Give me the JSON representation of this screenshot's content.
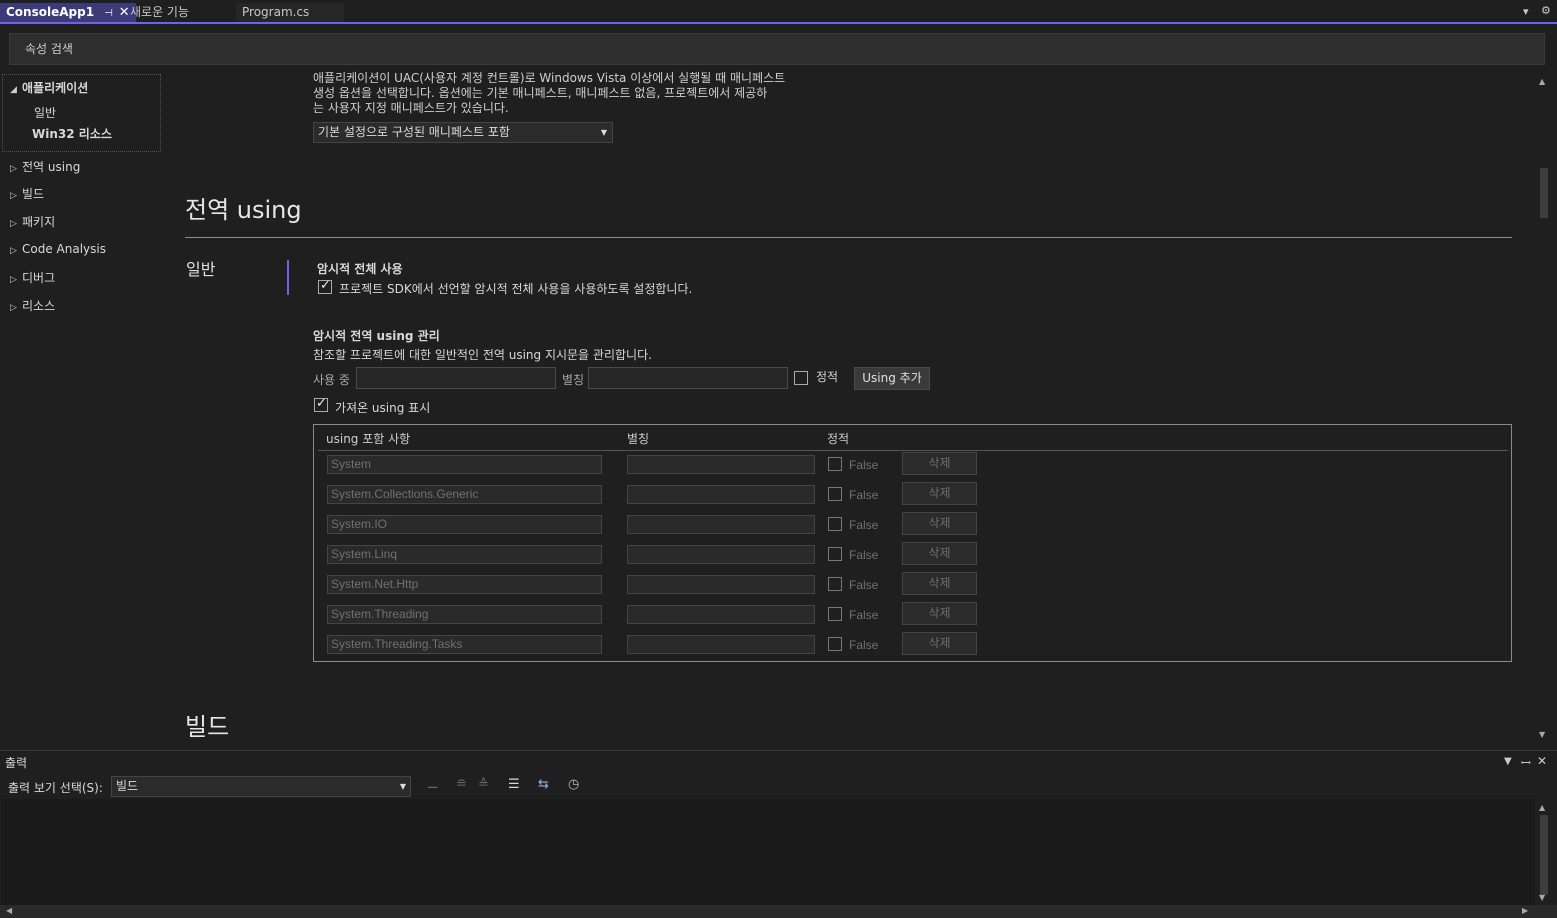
{
  "tabs": [
    {
      "label": "ConsoleApp1",
      "active": true
    },
    {
      "label": "새로운 기능",
      "active": false
    },
    {
      "label": "Program.cs",
      "active": false
    }
  ],
  "search": {
    "placeholder": "속성 검색"
  },
  "nav": {
    "expanded": {
      "label": "애플리케이션",
      "children": [
        "일반",
        "Win32 리소스"
      ]
    },
    "items": [
      "전역 using",
      "빌드",
      "패키지",
      "Code Analysis",
      "디버그",
      "리소스"
    ]
  },
  "manifest": {
    "description_lines": [
      "애플리케이션이 UAC(사용자 계정 컨트롤)로 Windows Vista 이상에서 실행될 때 매니페스트",
      "생성 옵션을 선택합니다. 옵션에는 기본 매니페스트, 매니페스트 없음, 프로젝트에서 제공하",
      "는 사용자 지정 매니페스트가 있습니다."
    ],
    "selected": "기본 설정으로 구성된 매니페스트 포함"
  },
  "global_using": {
    "heading": "전역 using",
    "subsection": "일반",
    "implicit": {
      "title": "암시적 전체 사용",
      "checkbox_label": "프로젝트 SDK에서 선언할 암시적 전체 사용을 사용하도록 설정합니다.",
      "checked": true
    },
    "manage": {
      "title": "암시적 전역 using 관리",
      "desc": "참조할 프로젝트에 대한 일반적인 전역 using 지시문을 관리합니다.",
      "using_label": "사용 중",
      "alias_label": "별칭",
      "static_label": "정적",
      "add_button": "Using 추가",
      "show_imported_label": "가져온 using 표시",
      "show_imported_checked": true
    },
    "table": {
      "headers": [
        "using 포함 사항",
        "별칭",
        "정적"
      ],
      "rows": [
        {
          "using": "System",
          "static": "False",
          "delete": "삭제"
        },
        {
          "using": "System.Collections.Generic",
          "static": "False",
          "delete": "삭제"
        },
        {
          "using": "System.IO",
          "static": "False",
          "delete": "삭제"
        },
        {
          "using": "System.Linq",
          "static": "False",
          "delete": "삭제"
        },
        {
          "using": "System.Net.Http",
          "static": "False",
          "delete": "삭제"
        },
        {
          "using": "System.Threading",
          "static": "False",
          "delete": "삭제"
        },
        {
          "using": "System.Threading.Tasks",
          "static": "False",
          "delete": "삭제"
        }
      ]
    }
  },
  "next_heading": "빌드",
  "output": {
    "title": "출력",
    "select_label": "출력 보기 선택(S):",
    "selected": "빌드"
  },
  "colors": {
    "accent": "#7160e8",
    "background": "#1f1f1f"
  }
}
